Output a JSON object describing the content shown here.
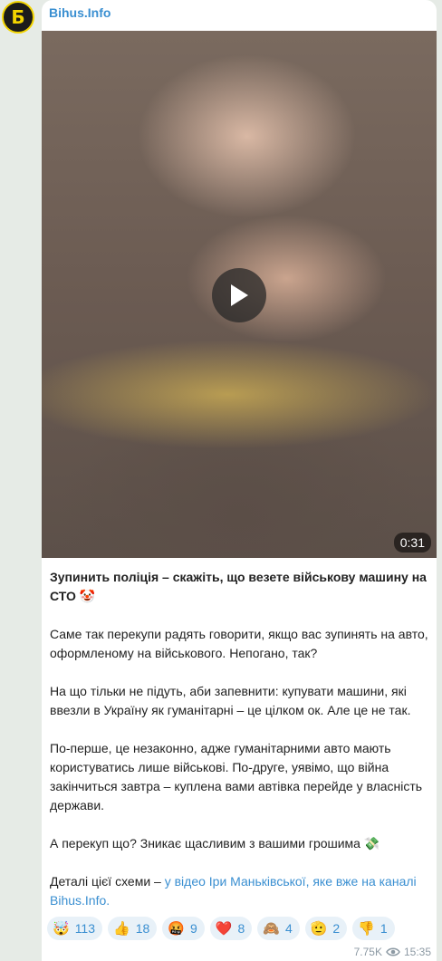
{
  "channel": {
    "name": "Bihus.Info",
    "avatar_letter": "Б"
  },
  "video": {
    "duration": "0:31"
  },
  "post": {
    "title": "Зупинить поліція – скажіть, що везете військову машину на СТО",
    "title_emoji": "🤡",
    "p1": "Саме так перекупи радять говорити, якщо вас зупинять на авто, оформленому на військового. Непогано, так?",
    "p2": "На що тільки не підуть, аби запевнити: купувати машини, які ввезли в Україну як гуманітарні – це цілком ок. Але це не так.",
    "p3": "По-перше, це незаконно, адже гуманітарними авто мають користуватись лише військові. По-друге, уявімо, що війна закінчиться завтра – куплена вами автівка перейде у власність держави.",
    "p4": "А перекуп що? Зникає щасливим з вашими грошима",
    "p4_emoji": "💸",
    "p5_prefix": "Деталі цієї схеми – ",
    "p5_link": "у відео Іри Маньківської, яке вже на каналі Bihus.Info."
  },
  "reactions": [
    {
      "emoji": "🤯",
      "count": "113"
    },
    {
      "emoji": "👍",
      "count": "18"
    },
    {
      "emoji": "🤬",
      "count": "9"
    },
    {
      "emoji": "❤️",
      "count": "8"
    },
    {
      "emoji": "🙈",
      "count": "4"
    },
    {
      "emoji": "🫡",
      "count": "2"
    },
    {
      "emoji": "👎",
      "count": "1"
    }
  ],
  "meta": {
    "views": "7.75K",
    "time": "15:35"
  }
}
